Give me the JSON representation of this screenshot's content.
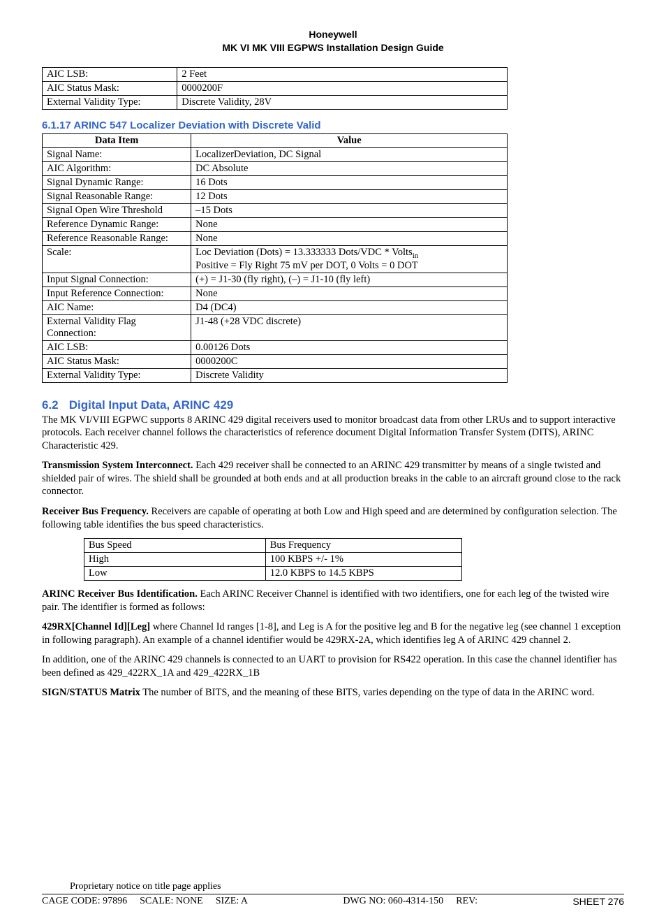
{
  "header": {
    "company": "Honeywell",
    "title": "MK VI  MK VIII EGPWS Installation Design Guide"
  },
  "top_table": {
    "rows": [
      {
        "label": "AIC LSB:",
        "value": "2 Feet"
      },
      {
        "label": "AIC Status Mask:",
        "value": "0000200F"
      },
      {
        "label": "External Validity Type:",
        "value": "Discrete Validity, 28V"
      }
    ]
  },
  "section6117": {
    "heading": "6.1.17 ARINC 547 Localizer Deviation with Discrete Valid",
    "header": {
      "c1": "Data Item",
      "c2": "Value"
    },
    "rows": [
      {
        "label": "Signal Name:",
        "value": "LocalizerDeviation, DC Signal"
      },
      {
        "label": "AIC Algorithm:",
        "value": "DC Absolute"
      },
      {
        "label": "Signal Dynamic Range:",
        "value": "16 Dots"
      },
      {
        "label": "Signal Reasonable Range:",
        "value": "12 Dots"
      },
      {
        "label": "Signal Open Wire Threshold",
        "value": "–15 Dots"
      },
      {
        "label": "Reference Dynamic Range:",
        "value": "None"
      },
      {
        "label": "Reference Reasonable Range:",
        "value": "None"
      },
      {
        "label": "Scale:",
        "value_line1_pre": "Loc Deviation (Dots) = 13.333333 Dots/VDC * Volts",
        "value_line1_sub": "in",
        "value_line2": "Positive = Fly Right     75 mV per DOT, 0 Volts = 0 DOT"
      },
      {
        "label": "Input Signal Connection:",
        "value": "(+) = J1-30 (fly right),  (–) = J1-10 (fly left)"
      },
      {
        "label": "Input Reference Connection:",
        "value": "None"
      },
      {
        "label": "AIC Name:",
        "value": "D4 (DC4)"
      },
      {
        "label": "External Validity Flag Connection:",
        "value": "J1-48 (+28 VDC discrete)"
      },
      {
        "label": "AIC LSB:",
        "value": "0.00126 Dots"
      },
      {
        "label": "AIC Status Mask:",
        "value": "0000200C"
      },
      {
        "label": "External Validity Type:",
        "value": "Discrete Validity"
      }
    ]
  },
  "section62": {
    "num": "6.2",
    "title": "Digital Input Data, ARINC 429",
    "p1": "The MK VI/VIII EGPWC supports 8 ARINC 429 digital receivers used to monitor broadcast data from other LRUs and to support interactive protocols.  Each receiver channel follows the characteristics of reference document Digital Information Transfer System (DITS), ARINC Characteristic 429.",
    "p2_bold": "Transmission System Interconnect.",
    "p2_rest": "  Each 429 receiver shall be connected to an ARINC 429 transmitter by means of a single twisted and shielded pair of wires.  The shield shall be grounded at both ends and at all production breaks in the cable to an aircraft ground close to the rack connector.",
    "p3_bold": "Receiver Bus Frequency.",
    "p3_rest": " Receivers are capable of operating at both Low and High speed and are determined by configuration selection. The following table identifies the bus speed characteristics.",
    "bus_table": {
      "header": {
        "c1": "Bus Speed",
        "c2": "Bus Frequency"
      },
      "rows": [
        {
          "speed": "High",
          "freq": "100 KBPS +/- 1%"
        },
        {
          "speed": "Low",
          "freq": "12.0 KBPS to 14.5 KBPS"
        }
      ]
    },
    "p4_bold": "ARINC Receiver Bus Identification.",
    "p4_rest": "  Each ARINC Receiver Channel is identified with two identifiers, one for each leg of the twisted wire pair.  The identifier is formed as follows:",
    "p5_bold": "429RX[Channel Id][Leg]",
    "p5_rest": " where Channel Id ranges [1-8], and Leg is A for the positive leg and B for the negative leg (see channel 1 exception in following paragraph).  An example of a channel identifier would be 429RX-2A, which identifies leg A of ARINC 429 channel 2.",
    "p6": "In addition, one of the ARINC 429 channels is connected to an UART to provision for RS422 operation. In this case the channel identifier has been defined as 429_422RX_1A and 429_422RX_1B",
    "p7_bold": "SIGN/STATUS Matrix",
    "p7_rest": "  The number of BITS, and the meaning of these BITS, varies depending on the type of data in the ARINC word."
  },
  "footer": {
    "notice": "Proprietary notice on title page applies",
    "cage": "CAGE CODE: 97896",
    "scale": "SCALE: NONE",
    "size": "SIZE: A",
    "dwg": "DWG NO: 060-4314-150",
    "rev": "REV:",
    "sheet_label": "SHEET ",
    "sheet_no": "276"
  }
}
